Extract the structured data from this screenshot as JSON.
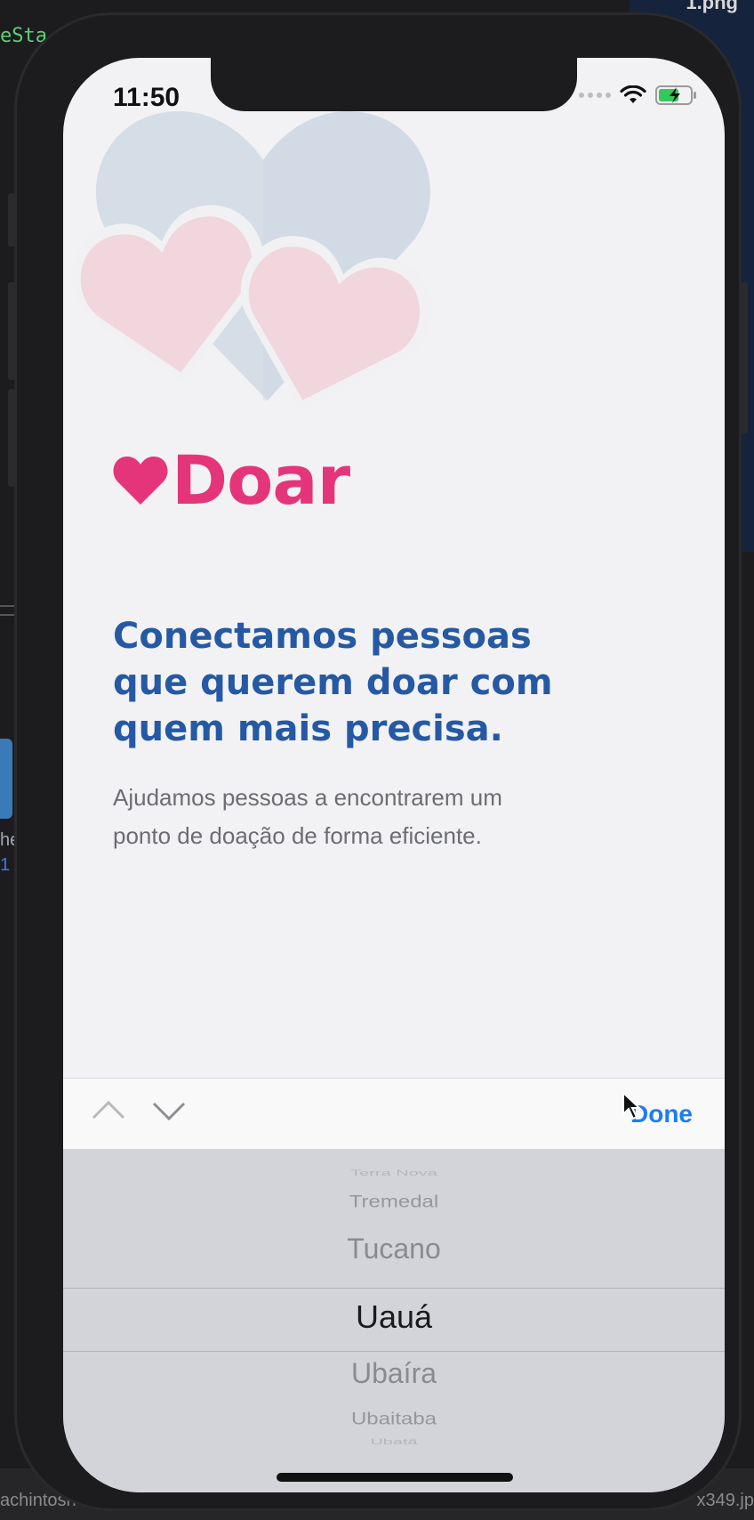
{
  "desktop": {
    "code_fragment": "eSta",
    "file_label": "1.png",
    "bottom_left": "achintosh",
    "bottom_right": "x349.jp",
    "side_text": [
      "he",
      "1"
    ]
  },
  "status_bar": {
    "time": "11:50"
  },
  "app": {
    "logo_text": "Doar",
    "headline": "Conectamos pessoas que querem doar com quem mais precisa.",
    "subline": "Ajudamos pessoas a encontrarem um ponto de doação de forma eficiente."
  },
  "toolbar": {
    "previous_icon": "chevron-up-icon",
    "next_icon": "chevron-down-icon",
    "done_label": "Done"
  },
  "picker": {
    "items": [
      "Terra Nova",
      "Tremedal",
      "Tucano",
      "Uauá",
      "Ubaíra",
      "Ubaitaba",
      "Ubatã"
    ],
    "selected": "Uauá"
  },
  "colors": {
    "brand_pink": "#e5357a",
    "headline_blue": "#2559a3",
    "done_blue": "#1e7cf2"
  }
}
